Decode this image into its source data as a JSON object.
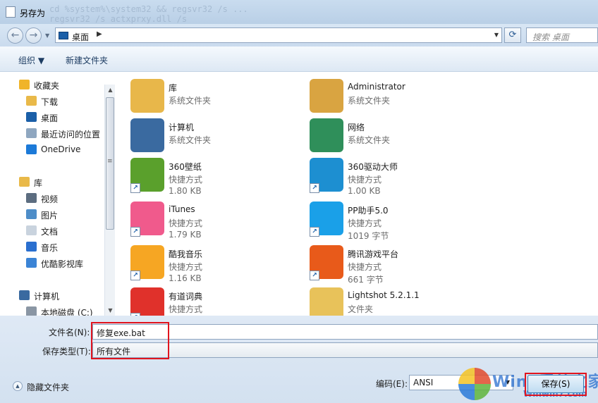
{
  "window": {
    "title": "另存为",
    "background_text_lines": [
      "cd %system%\\system32 && regsvr32 /s ...",
      "regsvr32 /s actxprxy.dll /s"
    ]
  },
  "nav": {
    "back_label": "←",
    "forward_label": "→",
    "location": "桌面",
    "refresh_label": "⟳",
    "search_placeholder": "搜索 桌面"
  },
  "toolbar": {
    "organize": "组织 ▼",
    "new_folder": "新建文件夹"
  },
  "sidebar": {
    "items": [
      {
        "label": "收藏夹",
        "icon": "star-icon",
        "color": "#f0b429",
        "indent": 0
      },
      {
        "label": "下载",
        "icon": "download-folder-icon",
        "color": "#e9b949",
        "indent": 1
      },
      {
        "label": "桌面",
        "icon": "desktop-icon",
        "color": "#1b5fa8",
        "indent": 1
      },
      {
        "label": "最近访问的位置",
        "icon": "recent-places-icon",
        "color": "#8fa7c0",
        "indent": 1
      },
      {
        "label": "OneDrive",
        "icon": "onedrive-icon",
        "color": "#1c7ad8",
        "indent": 1
      },
      {
        "label": "库",
        "icon": "library-icon",
        "color": "#e9b949",
        "indent": 0
      },
      {
        "label": "视频",
        "icon": "video-icon",
        "color": "#5c6d80",
        "indent": 1
      },
      {
        "label": "图片",
        "icon": "pictures-icon",
        "color": "#4e8dc8",
        "indent": 1
      },
      {
        "label": "文档",
        "icon": "documents-icon",
        "color": "#c9d3de",
        "indent": 1
      },
      {
        "label": "音乐",
        "icon": "music-icon",
        "color": "#2a6fcf",
        "indent": 1
      },
      {
        "label": "优酷影视库",
        "icon": "youku-icon",
        "color": "#3b84d6",
        "indent": 1
      },
      {
        "label": "计算机",
        "icon": "computer-icon",
        "color": "#3a6aa0",
        "indent": 0
      },
      {
        "label": "本地磁盘 (C:)",
        "icon": "drive-icon",
        "color": "#8a96a4",
        "indent": 1
      }
    ]
  },
  "files": [
    {
      "name": "库",
      "line2": "系统文件夹",
      "line3": "",
      "icon": "library-folder-icon",
      "color": "#e8b74a",
      "shortcut": false
    },
    {
      "name": "Administrator",
      "line2": "系统文件夹",
      "line3": "",
      "icon": "user-folder-icon",
      "color": "#d9a441",
      "shortcut": false
    },
    {
      "name": "计算机",
      "line2": "系统文件夹",
      "line3": "",
      "icon": "computer-icon",
      "color": "#3a6aa0",
      "shortcut": false
    },
    {
      "name": "网络",
      "line2": "系统文件夹",
      "line3": "",
      "icon": "network-globe-icon",
      "color": "#2f8f5a",
      "shortcut": false
    },
    {
      "name": "360壁纸",
      "line2": "快捷方式",
      "line3": "1.80 KB",
      "icon": "wallpaper-app-icon",
      "color": "#5aa02c",
      "shortcut": true
    },
    {
      "name": "360驱动大师",
      "line2": "快捷方式",
      "line3": "1.00 KB",
      "icon": "driver-master-icon",
      "color": "#1d8fd1",
      "shortcut": true
    },
    {
      "name": "iTunes",
      "line2": "快捷方式",
      "line3": "1.79 KB",
      "icon": "itunes-icon",
      "color": "#f05a8c",
      "shortcut": true
    },
    {
      "name": "PP助手5.0",
      "line2": "快捷方式",
      "line3": "1019 字节",
      "icon": "pp-assistant-icon",
      "color": "#1aa0e8",
      "shortcut": true
    },
    {
      "name": "酷我音乐",
      "line2": "快捷方式",
      "line3": "1.16 KB",
      "icon": "kuwo-music-icon",
      "color": "#f6a623",
      "shortcut": true
    },
    {
      "name": "腾讯游戏平台",
      "line2": "快捷方式",
      "line3": "661 字节",
      "icon": "tencent-games-icon",
      "color": "#e85a1a",
      "shortcut": true
    },
    {
      "name": "有道词典",
      "line2": "快捷方式",
      "line3": "",
      "icon": "youdao-dict-icon",
      "color": "#e0312b",
      "shortcut": true
    },
    {
      "name": "Lightshot 5.2.1.1",
      "line2": "文件夹",
      "line3": "",
      "icon": "folder-icon",
      "color": "#e8c25a",
      "shortcut": false
    }
  ],
  "form": {
    "filename_label": "文件名(N):",
    "filename_value": "修复exe.bat",
    "filetype_label": "保存类型(T):",
    "filetype_value": "所有文件",
    "hide_folders": "隐藏文件夹",
    "encoding_label": "编码(E):",
    "encoding_value": "ANSI",
    "save_button": "保存(S)",
    "highlight_color": "#e1141e"
  },
  "watermark": {
    "text": "Win7系统之家",
    "sub": "Winwin7.com"
  }
}
